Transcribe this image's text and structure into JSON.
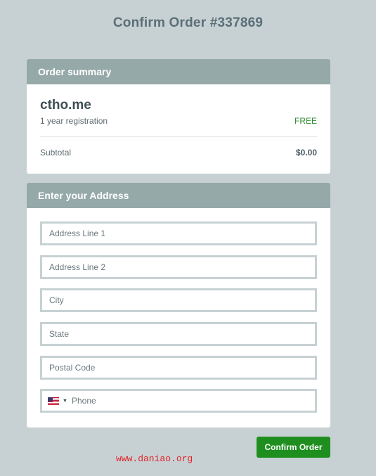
{
  "page": {
    "title": "Confirm Order #337869"
  },
  "summary": {
    "header": "Order summary",
    "product_name": "ctho.me",
    "product_desc": "1 year registration",
    "product_price": "FREE",
    "subtotal_label": "Subtotal",
    "subtotal_value": "$0.00",
    "price_color": "#2f8f2f"
  },
  "address": {
    "header": "Enter your Address",
    "fields": {
      "line1": {
        "placeholder": "Address Line 1",
        "value": ""
      },
      "line2": {
        "placeholder": "Address Line 2",
        "value": ""
      },
      "city": {
        "placeholder": "City",
        "value": ""
      },
      "state": {
        "placeholder": "State",
        "value": ""
      },
      "postal": {
        "placeholder": "Postal Code",
        "value": ""
      },
      "phone": {
        "placeholder": "Phone",
        "value": "",
        "country_icon": "us-flag-icon"
      }
    }
  },
  "actions": {
    "confirm_label": "Confirm Order",
    "confirm_color": "#1e8f1e"
  },
  "watermark": {
    "text": "www.daniao.org",
    "color": "#e0242c"
  },
  "theme": {
    "background": "#c7d1d3",
    "header_bg": "#96a9a9",
    "title_color": "#5b6f78"
  }
}
